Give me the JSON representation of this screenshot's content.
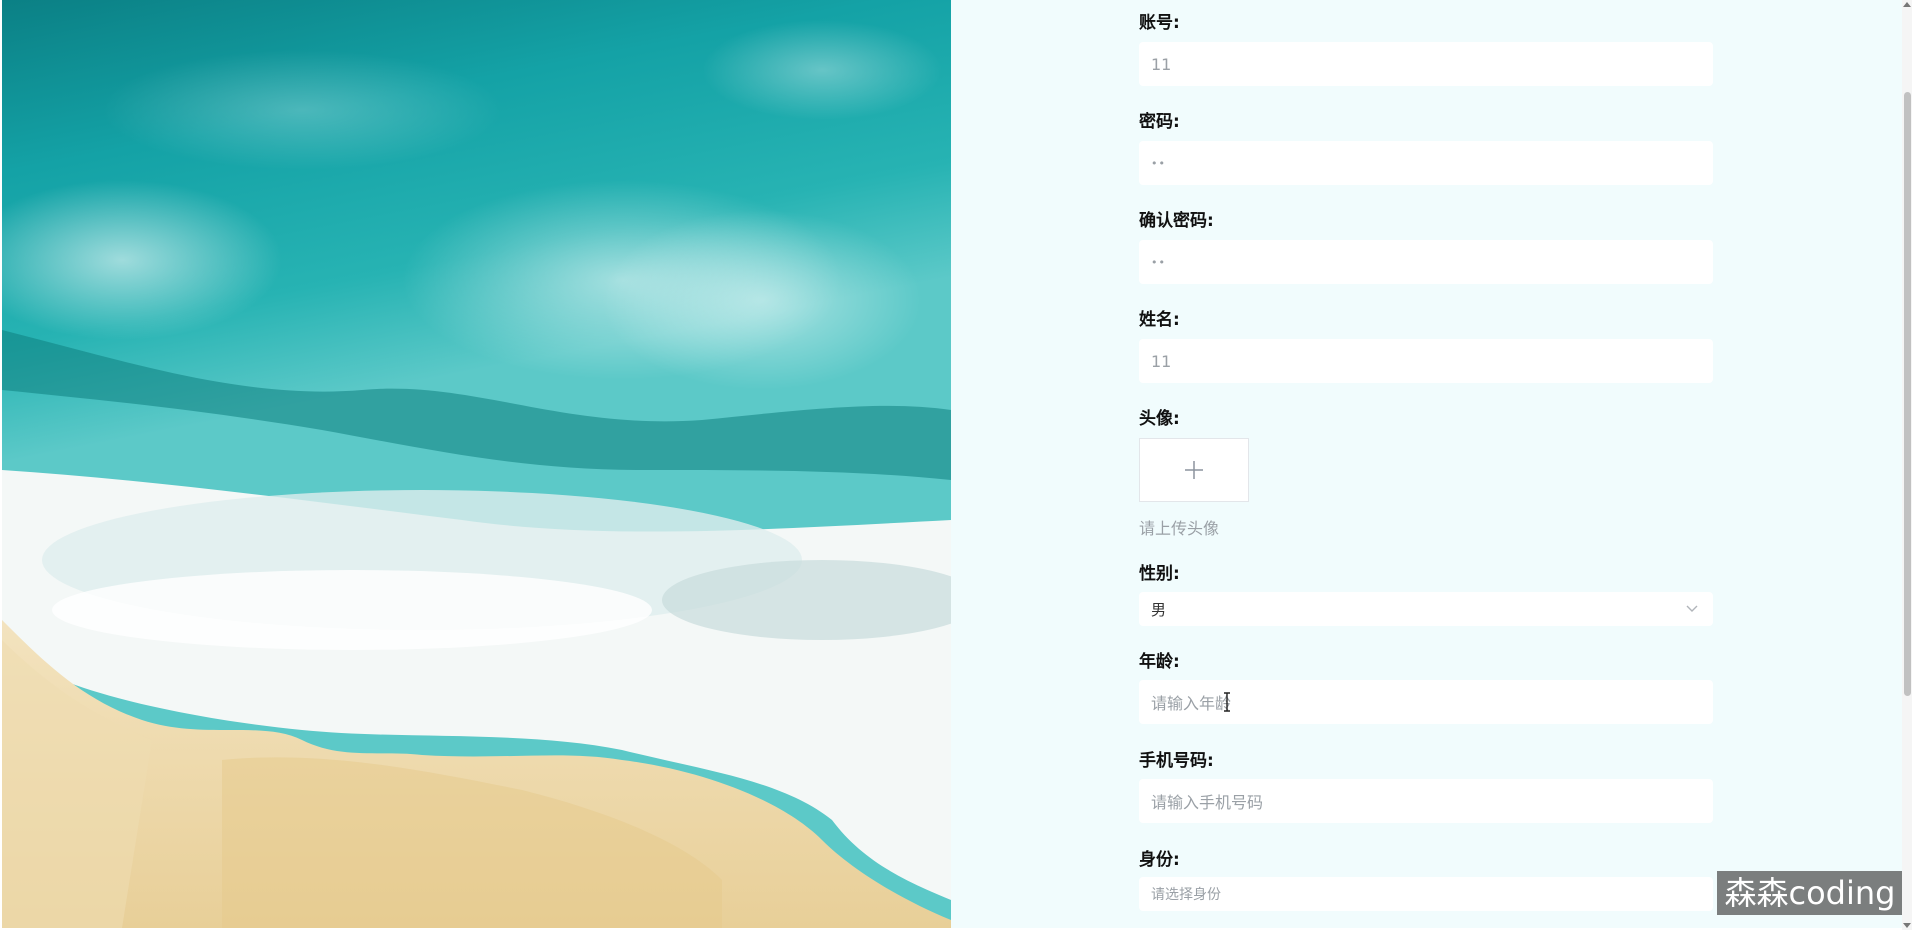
{
  "form": {
    "account": {
      "label": "账号:",
      "value": "11"
    },
    "password": {
      "label": "密码:",
      "value": "••"
    },
    "confirm_password": {
      "label": "确认密码:",
      "value": "••"
    },
    "name": {
      "label": "姓名:",
      "value": "11"
    },
    "avatar": {
      "label": "头像:",
      "hint": "请上传头像",
      "icon": "plus-icon"
    },
    "gender": {
      "label": "性别:",
      "value": "男",
      "icon": "chevron-down-icon"
    },
    "age": {
      "label": "年龄:",
      "placeholder": "请输入年龄"
    },
    "phone": {
      "label": "手机号码:",
      "placeholder": "请输入手机号码"
    },
    "role": {
      "label": "身份:",
      "placeholder": "请选择身份"
    }
  },
  "watermark": {
    "text": "森森coding"
  },
  "colors": {
    "form_background": "#f1fcfd",
    "input_background": "#ffffff",
    "placeholder": "#9aa0a6"
  }
}
